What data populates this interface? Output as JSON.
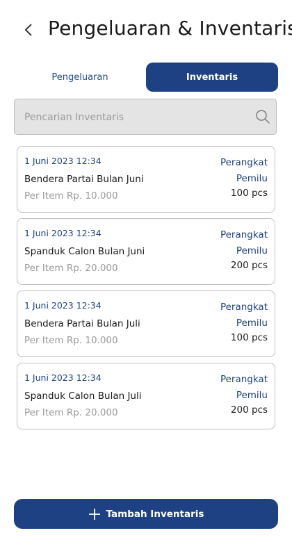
{
  "header": {
    "title": "Pengeluaran & Inventaris"
  },
  "tabs": [
    {
      "label": "Pengeluaran",
      "active": false
    },
    {
      "label": "Inventaris",
      "active": true
    }
  ],
  "search": {
    "placeholder": "Pencarian Inventaris",
    "value": ""
  },
  "items": [
    {
      "date": "1 Juni 2023 12:34",
      "name": "Bendera Partai Bulan Juni",
      "price": "Per Item Rp. 10.000",
      "category_line1": "Perangkat",
      "category_line2": "Pemilu",
      "qty": "100 pcs"
    },
    {
      "date": "1 Juni 2023 12:34",
      "name": "Spanduk Calon Bulan Juni",
      "price": "Per Item Rp. 20.000",
      "category_line1": "Perangkat",
      "category_line2": "Pemilu",
      "qty": "200 pcs"
    },
    {
      "date": "1 Juni 2023 12:34",
      "name": "Bendera Partai Bulan Juli",
      "price": "Per Item Rp. 10.000",
      "category_line1": "Perangkat",
      "category_line2": "Pemilu",
      "qty": "100 pcs"
    },
    {
      "date": "1 Juni 2023 12:34",
      "name": "Spanduk Calon Bulan Juli",
      "price": "Per Item Rp. 20.000",
      "category_line1": "Perangkat",
      "category_line2": "Pemilu",
      "qty": "200 pcs"
    }
  ],
  "add_button": {
    "label": "Tambah Inventaris"
  },
  "colors": {
    "primary": "#1d4183",
    "border": "#bfbfbf",
    "muted": "#9a9a9a",
    "search_bg": "#e4e4e4"
  },
  "icons": {
    "back": "chevron-left-icon",
    "search": "search-icon",
    "add": "plus-icon"
  }
}
